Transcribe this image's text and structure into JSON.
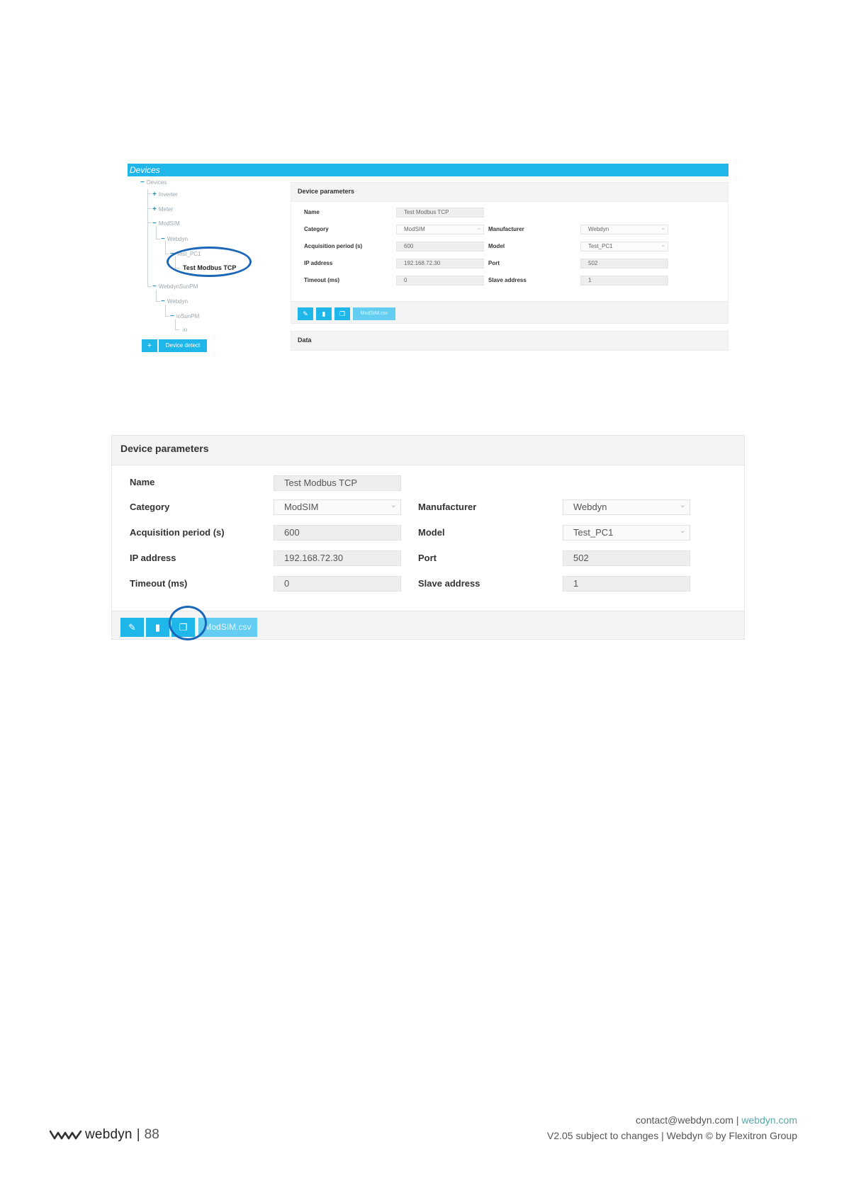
{
  "screenshot1": {
    "title": "Devices",
    "tree": {
      "root": "Devices",
      "items": [
        "Inverter",
        "Meter",
        "ModSIM",
        "Webdyn",
        "Test_PC1",
        "Test Modbus TCP",
        "WebdynSunPM",
        "Webdyn",
        "ioSunPM",
        "io"
      ]
    },
    "detect_button": "Device detect",
    "panel_title": "Device parameters",
    "fields": {
      "name_label": "Name",
      "name_value": "Test  Modbus TCP",
      "category_label": "Category",
      "category_value": "ModSIM",
      "manufacturer_label": "Manufacturer",
      "manufacturer_value": "Webdyn",
      "acq_label": "Acquisition period (s)",
      "acq_value": "600",
      "model_label": "Model",
      "model_value": "Test_PC1",
      "ip_label": "IP address",
      "ip_value": "192.168.72.30",
      "port_label": "Port",
      "port_value": "502",
      "timeout_label": "Timeout (ms)",
      "timeout_value": "0",
      "slave_label": "Slave address",
      "slave_value": "1"
    },
    "csv_button": "ModSIM.csv",
    "data_title": "Data"
  },
  "screenshot2": {
    "panel_title": "Device parameters",
    "fields": {
      "name_label": "Name",
      "name_value": "Test  Modbus TCP",
      "category_label": "Category",
      "category_value": "ModSIM",
      "manufacturer_label": "Manufacturer",
      "manufacturer_value": "Webdyn",
      "acq_label": "Acquisition period (s)",
      "acq_value": "600",
      "model_label": "Model",
      "model_value": "Test_PC1",
      "ip_label": "IP address",
      "ip_value": "192.168.72.30",
      "port_label": "Port",
      "port_value": "502",
      "timeout_label": "Timeout (ms)",
      "timeout_value": "0",
      "slave_label": "Slave address",
      "slave_value": "1"
    },
    "csv_button": "ModSIM.csv"
  },
  "icons": {
    "edit": "pencil-icon",
    "delete": "trash-icon",
    "copy": "copy-icon",
    "add": "plus-icon"
  },
  "footer": {
    "brand": "webdyn",
    "separator": "|",
    "page_number": "88",
    "contact_email": "contact@webdyn.com",
    "contact_sep": "|",
    "website": "webdyn.com",
    "version_line": "V2.05 subject to changes  |  Webdyn © by Flexitron Group"
  },
  "colors": {
    "accent": "#1fb6ea",
    "accent_light": "#63cdf2",
    "highlight_ring": "#1a66b8",
    "link": "#5aa7a7"
  }
}
